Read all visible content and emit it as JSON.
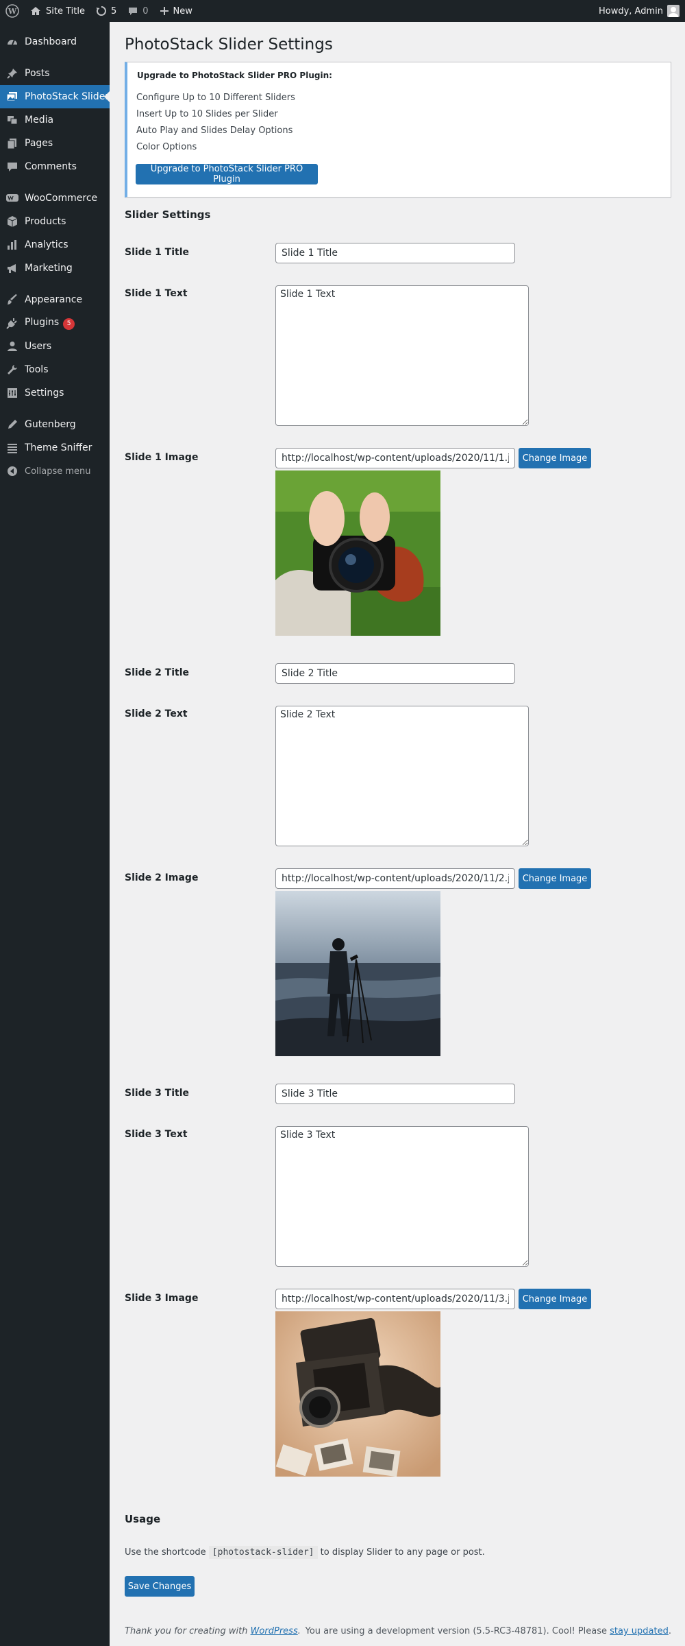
{
  "adminbar": {
    "site_title": "Site Title",
    "updates_count": "5",
    "comments_count": "0",
    "new_label": "New",
    "howdy": "Howdy, Admin"
  },
  "sidebar": {
    "items": [
      {
        "label": "Dashboard",
        "icon": "dashboard-icon"
      },
      {
        "label": "Posts",
        "icon": "pin-icon"
      },
      {
        "label": "PhotoStack Slider",
        "icon": "images-icon"
      },
      {
        "label": "Media",
        "icon": "media-icon"
      },
      {
        "label": "Pages",
        "icon": "pages-icon"
      },
      {
        "label": "Comments",
        "icon": "comment-icon"
      },
      {
        "label": "WooCommerce",
        "icon": "woo-icon"
      },
      {
        "label": "Products",
        "icon": "box-icon"
      },
      {
        "label": "Analytics",
        "icon": "bar-chart-icon"
      },
      {
        "label": "Marketing",
        "icon": "megaphone-icon"
      },
      {
        "label": "Appearance",
        "icon": "brush-icon"
      },
      {
        "label": "Plugins",
        "icon": "plug-icon"
      },
      {
        "label": "Users",
        "icon": "user-icon"
      },
      {
        "label": "Tools",
        "icon": "wrench-icon"
      },
      {
        "label": "Settings",
        "icon": "sliders-icon"
      },
      {
        "label": "Gutenberg",
        "icon": "pen-icon"
      },
      {
        "label": "Theme Sniffer",
        "icon": "list-icon"
      }
    ],
    "plugins_badge": "5",
    "collapse_label": "Collapse menu"
  },
  "page": {
    "title": "PhotoStack Slider Settings",
    "notice": {
      "heading": "Upgrade to PhotoStack Slider PRO Plugin:",
      "lines": [
        "Configure Up to 10 Different Sliders",
        "Insert Up to 10 Slides per Slider",
        "Auto Play and Slides Delay Options",
        "Color Options"
      ],
      "button": "Upgrade to PhotoStack Slider PRO Plugin"
    },
    "section_title": "Slider Settings",
    "change_image_label": "Change Image",
    "slides": [
      {
        "title_label": "Slide 1 Title",
        "title_value": "Slide 1 Title",
        "text_label": "Slide 1 Text",
        "text_value": "Slide 1 Text",
        "image_label": "Slide 1 Image",
        "image_url": "http://localhost/wp-content/uploads/2020/11/1.jpg"
      },
      {
        "title_label": "Slide 2 Title",
        "title_value": "Slide 2 Title",
        "text_label": "Slide 2 Text",
        "text_value": "Slide 2 Text",
        "image_label": "Slide 2 Image",
        "image_url": "http://localhost/wp-content/uploads/2020/11/2.jpg"
      },
      {
        "title_label": "Slide 3 Title",
        "title_value": "Slide 3 Title",
        "text_label": "Slide 3 Text",
        "text_value": "Slide 3 Text",
        "image_label": "Slide 3 Image",
        "image_url": "http://localhost/wp-content/uploads/2020/11/3.jpg"
      }
    ],
    "usage": {
      "title": "Usage",
      "before": "Use the shortcode",
      "shortcode": "[photostack-slider]",
      "after": "to display Slider to any page or post."
    },
    "save_button": "Save Changes"
  },
  "footer": {
    "left_before": "Thank you for creating with ",
    "left_link": "WordPress",
    "left_after": ".",
    "right_before": "You are using a development version (5.5-RC3-48781). Cool! Please ",
    "right_link": "stay updated",
    "right_after": "."
  },
  "colors": {
    "admin_dark": "#1d2327",
    "accent_blue": "#2271b1",
    "notice_border": "#72aee6",
    "badge_red": "#d63638"
  }
}
